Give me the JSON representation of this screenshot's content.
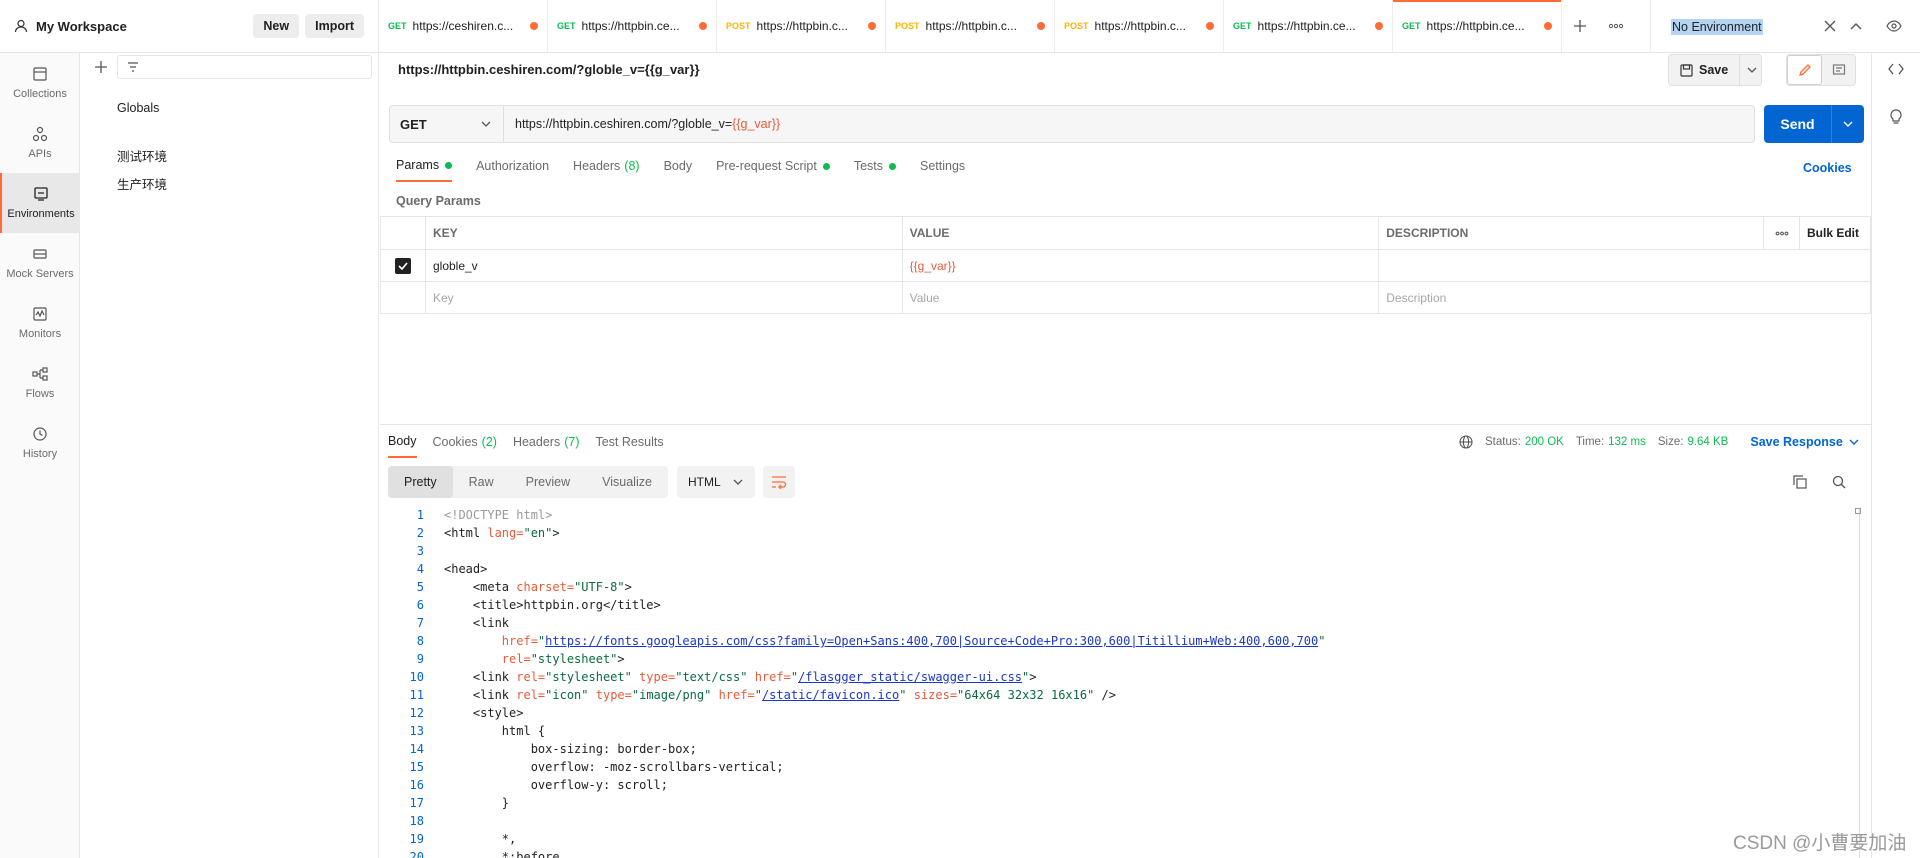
{
  "workspace": {
    "name": "My Workspace",
    "new_label": "New",
    "import_label": "Import"
  },
  "rail": [
    {
      "label": "Collections",
      "icon": "collections-icon"
    },
    {
      "label": "APIs",
      "icon": "apis-icon"
    },
    {
      "label": "Environments",
      "icon": "environments-icon",
      "active": true
    },
    {
      "label": "Mock Servers",
      "icon": "mock-servers-icon"
    },
    {
      "label": "Monitors",
      "icon": "monitors-icon"
    },
    {
      "label": "Flows",
      "icon": "flows-icon"
    },
    {
      "label": "History",
      "icon": "history-icon"
    }
  ],
  "environments": {
    "globals": "Globals",
    "items": [
      "测试环境",
      "生产环境"
    ]
  },
  "tabs": [
    {
      "method": "GET",
      "url": "https://ceshiren.c..."
    },
    {
      "method": "GET",
      "url": "https://httpbin.ce..."
    },
    {
      "method": "POST",
      "url": "https://httpbin.c..."
    },
    {
      "method": "POST",
      "url": "https://httpbin.c..."
    },
    {
      "method": "POST",
      "url": "https://httpbin.c..."
    },
    {
      "method": "GET",
      "url": "https://httpbin.ce..."
    },
    {
      "method": "GET",
      "url": "https://httpbin.ce...",
      "active": true
    }
  ],
  "env_selector": "No Environment",
  "request": {
    "title": "https://httpbin.ceshiren.com/?globle_v={{g_var}}",
    "save_label": "Save",
    "method": "GET",
    "url_base": "https://httpbin.ceshiren.com/?globle_v=",
    "url_var": "{{g_var}}",
    "send_label": "Send",
    "subtabs": {
      "params": "Params",
      "authorization": "Authorization",
      "headers": "Headers",
      "headers_count": "(8)",
      "body": "Body",
      "prerequest": "Pre-request Script",
      "tests": "Tests",
      "settings": "Settings"
    },
    "cookies_label": "Cookies",
    "query_params_title": "Query Params",
    "table": {
      "headers": [
        "KEY",
        "VALUE",
        "DESCRIPTION"
      ],
      "bulk_edit": "Bulk Edit",
      "rows": [
        {
          "key": "globle_v",
          "value": "{{g_var}}",
          "description": ""
        }
      ],
      "placeholders": {
        "key": "Key",
        "value": "Value",
        "description": "Description"
      }
    }
  },
  "response": {
    "tabs": {
      "body": "Body",
      "cookies": "Cookies",
      "cookies_count": "(2)",
      "headers": "Headers",
      "headers_count": "(7)",
      "test_results": "Test Results"
    },
    "status_label": "Status:",
    "status_value": "200 OK",
    "time_label": "Time:",
    "time_value": "132 ms",
    "size_label": "Size:",
    "size_value": "9.64 KB",
    "save_response": "Save Response",
    "formats": [
      "Pretty",
      "Raw",
      "Preview",
      "Visualize"
    ],
    "language": "HTML"
  },
  "code_lines": [
    "1",
    "2",
    "3",
    "4",
    "5",
    "6",
    "7",
    "8",
    "9",
    "10",
    "11",
    "12",
    "13",
    "14",
    "15",
    "16",
    "17",
    "18",
    "19",
    "20"
  ],
  "code_text": {
    "l1": "<!DOCTYPE html>",
    "l2_tag": "<html",
    "l2_attr": " lang=",
    "l2_val": "\"en\"",
    "l2_end": ">",
    "l5_tag": "<meta",
    "l5_attr": " charset=",
    "l5_val": "\"UTF-8\"",
    "l5_end": ">",
    "l6": "<title>httpbin.org</title>",
    "l7": "<link",
    "l8_attr": "href=",
    "l8_val": "https://fonts.googleapis.com/css?family=Open+Sans:400,700|Source+Code+Pro:300,600|Titillium+Web:400,600,700",
    "l9_attr": "rel=",
    "l9_val": "\"stylesheet\"",
    "l10_a": "rel=",
    "l10_av": "\"stylesheet\"",
    "l10_b": " type=",
    "l10_bv": "\"text/css\"",
    "l10_c": " href=",
    "l10_cv": "/flasgger_static/swagger-ui.css",
    "l11_a": "rel=",
    "l11_av": "\"icon\"",
    "l11_b": " type=",
    "l11_bv": "\"image/png\"",
    "l11_c": " href=",
    "l11_cv": "/static/favicon.ico",
    "l11_d": " sizes=",
    "l11_dv": "\"64x64 32x32 16x16\"",
    "l12": "<style>",
    "l13": "html {",
    "l14": "box-sizing: border-box;",
    "l15": "overflow: -moz-scrollbars-vertical;",
    "l16": "overflow-y: scroll;",
    "l17": "}",
    "l19": "*,",
    "l20": "*:before,"
  },
  "watermark": "CSDN @小曹要加油",
  "colors": {
    "accent": "#ff6c37",
    "primary": "#0265d2",
    "success": "#0cbb52"
  }
}
